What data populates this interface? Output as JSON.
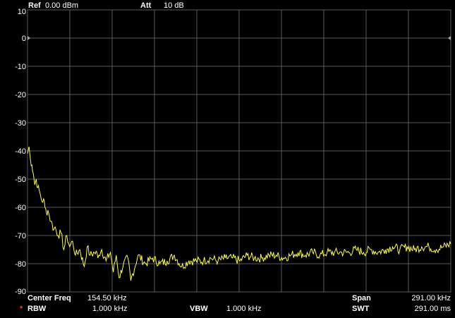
{
  "header": {
    "ref_label": "Ref",
    "ref_value": "0.00 dBm",
    "att_label": "Att",
    "att_value": "10 dB"
  },
  "footer": {
    "center_freq_label": "Center Freq",
    "center_freq_value": "154.50 kHz",
    "span_label": "Span",
    "span_value": "291.00 kHz",
    "rbw_marker": "*",
    "rbw_label": "RBW",
    "rbw_value": "1.000 kHz",
    "vbw_label": "VBW",
    "vbw_value": "1.000 kHz",
    "swt_label": "SWT",
    "swt_value": "291.00 ms"
  },
  "colors": {
    "background": "#000000",
    "grid": "#5a5a5a",
    "trace": "#ffff3c",
    "text": "#ffffff",
    "rbw_marker": "#ff3b3b",
    "reference_marker": "#aaaaaa"
  },
  "chart_data": {
    "type": "line",
    "y_tick_labels": [
      "10",
      "0",
      "-10",
      "-20",
      "-30",
      "-40",
      "-50",
      "-60",
      "-70",
      "-80",
      "-90"
    ],
    "ylim": [
      -90,
      10
    ],
    "xlim": [
      9,
      300
    ],
    "x_divisions": 10,
    "grid": true,
    "reference_level": 0,
    "series": [
      {
        "x": [
          9,
          10,
          11,
          12,
          13,
          14,
          15,
          16,
          17,
          18,
          19,
          20,
          21,
          22,
          23,
          24,
          25,
          26,
          27,
          28,
          30,
          32,
          34,
          36,
          38,
          40,
          42,
          45,
          48,
          50,
          52,
          55,
          58,
          60,
          63,
          66,
          68,
          70,
          72,
          75,
          78,
          80,
          85,
          90,
          95,
          100,
          105,
          110,
          115,
          120,
          125,
          130,
          135,
          140,
          145,
          150,
          155,
          160,
          165,
          170,
          175,
          180,
          185,
          190,
          195,
          200,
          205,
          210,
          215,
          220,
          225,
          230,
          235,
          240,
          245,
          250,
          255,
          260,
          265,
          270,
          275,
          280,
          285,
          290,
          295,
          300
        ],
        "values": [
          -41,
          -38.5,
          -43,
          -45,
          -48,
          -52,
          -50,
          -53,
          -54,
          -56,
          -58,
          -57,
          -60,
          -62,
          -61,
          -63,
          -65,
          -66,
          -68,
          -67,
          -70,
          -69,
          -75,
          -70,
          -74,
          -72,
          -77,
          -75,
          -81,
          -74,
          -77,
          -76,
          -77,
          -75,
          -79,
          -76,
          -83,
          -77,
          -85,
          -80,
          -78,
          -86,
          -77,
          -80,
          -78,
          -80,
          -79,
          -77,
          -81,
          -79,
          -79,
          -79,
          -78,
          -79,
          -78,
          -78,
          -79,
          -77,
          -78,
          -78,
          -77,
          -77,
          -78,
          -77,
          -76,
          -77,
          -76,
          -77,
          -76,
          -76,
          -76,
          -76,
          -75,
          -76,
          -75,
          -76,
          -75,
          -74,
          -75,
          -74,
          -75,
          -74,
          -74,
          -75,
          -74,
          -73
        ]
      }
    ]
  }
}
